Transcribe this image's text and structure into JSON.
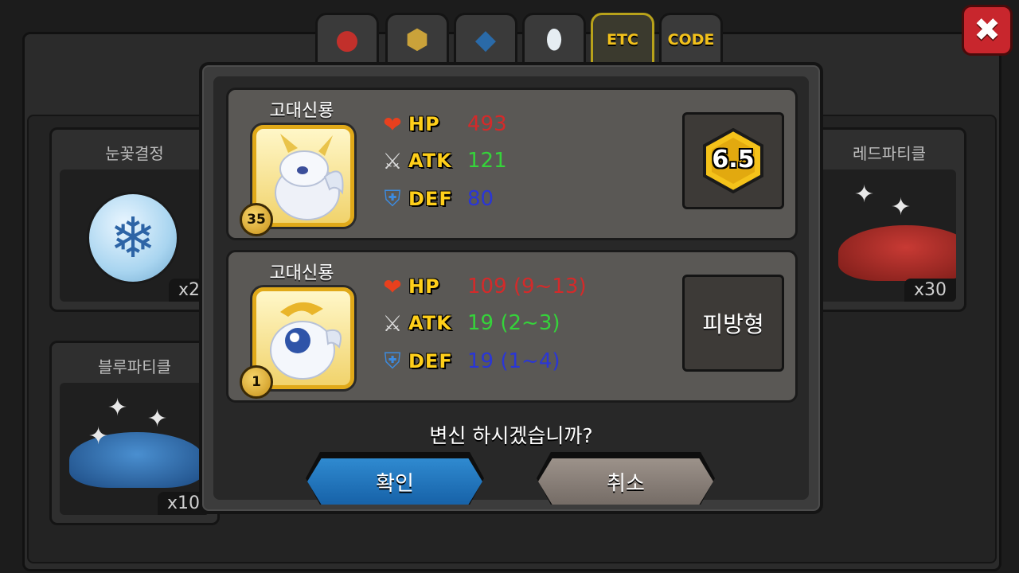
{
  "tabs": [
    {
      "icon": "fruit-icon",
      "label": ""
    },
    {
      "icon": "nugget-icon",
      "label": ""
    },
    {
      "icon": "feather-icon",
      "label": ""
    },
    {
      "icon": "egg-icon",
      "label": ""
    },
    {
      "icon": "",
      "label": "ETC"
    },
    {
      "icon": "",
      "label": "CODE"
    }
  ],
  "active_tab": "ETC",
  "inventory": {
    "items": [
      {
        "name": "눈꽃결정",
        "qty": "x2"
      },
      {
        "name": "레드파티클",
        "qty": "x30"
      },
      {
        "name": "블루파티클",
        "qty": "x10"
      }
    ]
  },
  "dialog": {
    "current": {
      "name": "고대신룡",
      "level": "35",
      "hp": "493",
      "atk": "121",
      "def": "80",
      "grade": "6.5"
    },
    "result": {
      "name": "고대신룡",
      "level": "1",
      "hp": "109 (9~13)",
      "atk": "19 (2~3)",
      "def": "19 (1~4)",
      "type": "피방형"
    },
    "stat_labels": {
      "hp": "HP",
      "atk": "ATK",
      "def": "DEF"
    },
    "question": "변신 하시겠습니까?",
    "confirm_label": "확인",
    "cancel_label": "취소"
  },
  "colors": {
    "hp": "#d42a2a",
    "atk": "#35d33a",
    "def": "#2a36d6",
    "stat_label": "#ffcf1a",
    "confirm_button": "#1f74bd",
    "cancel_button": "#8a817a",
    "close_button": "#c8262d"
  }
}
